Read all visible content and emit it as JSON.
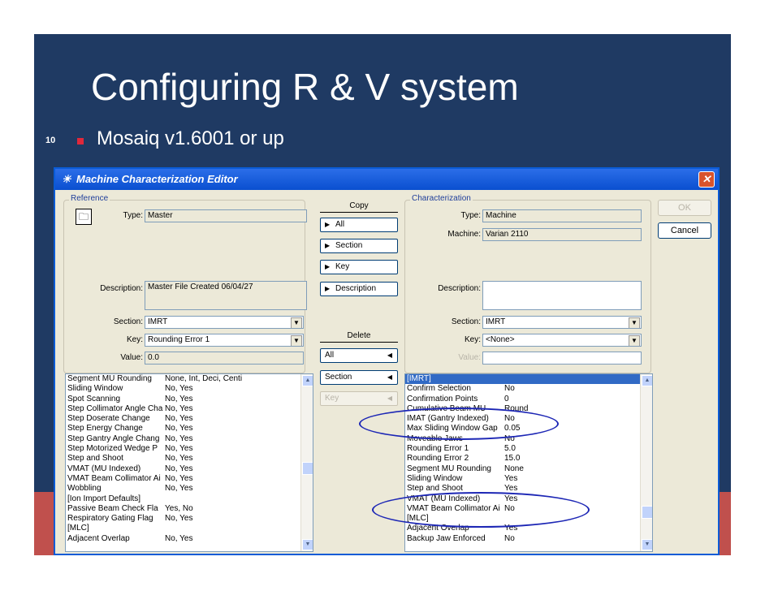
{
  "slide": {
    "number": "10",
    "title": "Configuring R & V system",
    "bullet": "Mosaiq v1.6001 or up"
  },
  "window": {
    "title": "Machine Characterization Editor",
    "icon": "app-icon",
    "close_glyph": "✕"
  },
  "reference": {
    "legend": "Reference",
    "type_label": "Type:",
    "type_value": "Master",
    "description_label": "Description:",
    "description_value": "Master File Created 06/04/27",
    "section_label": "Section:",
    "section_value": "IMRT",
    "key_label": "Key:",
    "key_value": "Rounding Error 1",
    "value_label": "Value:",
    "value_value": "0.0",
    "list": [
      [
        "Segment MU Rounding",
        "None, Int, Deci, Centi"
      ],
      [
        "Sliding Window",
        "No, Yes"
      ],
      [
        "Spot Scanning",
        "No, Yes"
      ],
      [
        "Step Collimator Angle Cha",
        "No, Yes"
      ],
      [
        "Step Doserate Change",
        "No, Yes"
      ],
      [
        "Step Energy Change",
        "No, Yes"
      ],
      [
        "Step Gantry Angle Chang",
        "No, Yes"
      ],
      [
        "Step Motorized Wedge P",
        "No, Yes"
      ],
      [
        "Step and Shoot",
        "No, Yes"
      ],
      [
        "VMAT (MU Indexed)",
        "No, Yes"
      ],
      [
        "VMAT Beam Collimator Ai",
        "No, Yes"
      ],
      [
        "Wobbling",
        "No, Yes"
      ],
      [
        "[Ion Import Defaults]",
        ""
      ],
      [
        "Passive Beam Check Fla",
        "Yes, No"
      ],
      [
        "Respiratory Gating Flag",
        "No, Yes"
      ],
      [
        "[MLC]",
        ""
      ],
      [
        "Adjacent Overlap",
        "No, Yes"
      ]
    ]
  },
  "copy": {
    "heading": "Copy",
    "all": "All",
    "section": "Section",
    "key": "Key",
    "description": "Description"
  },
  "delete": {
    "heading": "Delete",
    "all": "All",
    "section": "Section",
    "key": "Key"
  },
  "characterization": {
    "legend": "Characterization",
    "type_label": "Type:",
    "type_value": "Machine",
    "machine_label": "Machine:",
    "machine_value": "Varian 2110",
    "description_label": "Description:",
    "description_value": "",
    "section_label": "Section:",
    "section_value": "IMRT",
    "key_label": "Key:",
    "key_value": "<None>",
    "value_label": "Value:",
    "value_value": "",
    "list": [
      [
        "[IMRT]",
        ""
      ],
      [
        "Confirm Selection",
        "No"
      ],
      [
        "Confirmation Points",
        "0"
      ],
      [
        "Cumulative Beam MU",
        "Round"
      ],
      [
        "IMAT (Gantry Indexed)",
        "No"
      ],
      [
        "Max Sliding Window Gap",
        "0.05"
      ],
      [
        "Moveable Jaws",
        "No"
      ],
      [
        "Rounding Error 1",
        "5.0"
      ],
      [
        "Rounding Error 2",
        "15.0"
      ],
      [
        "Segment MU Rounding",
        "None"
      ],
      [
        "Sliding Window",
        "Yes"
      ],
      [
        "Step and Shoot",
        "Yes"
      ],
      [
        "VMAT (MU Indexed)",
        "Yes"
      ],
      [
        "VMAT Beam Collimator Ai",
        "No"
      ],
      [
        "[MLC]",
        ""
      ],
      [
        "Adjacent Overlap",
        "Yes"
      ],
      [
        "Backup Jaw Enforced",
        "No"
      ]
    ]
  },
  "buttons": {
    "ok": "OK",
    "cancel": "Cancel"
  },
  "colors": {
    "slide_bg": "#1f3a63",
    "accent_red": "#c0504d",
    "annotation_ellipse": "#1d27b5",
    "selection": "#316ac5"
  }
}
